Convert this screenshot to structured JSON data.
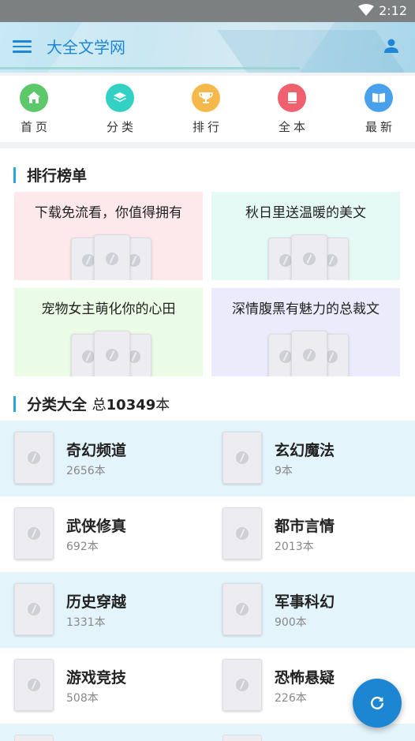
{
  "status_bar": {
    "time": "2:12"
  },
  "app_bar": {
    "title": "大全文学网",
    "menu_icon": "menu-icon",
    "user_icon": "user-icon"
  },
  "nav": [
    {
      "label": "首页",
      "icon": "home-icon",
      "color": "#5cc86a"
    },
    {
      "label": "分类",
      "icon": "layers-icon",
      "color": "#33d1c3"
    },
    {
      "label": "排行",
      "icon": "trophy-icon",
      "color": "#f5b84a"
    },
    {
      "label": "全本",
      "icon": "book-icon",
      "color": "#f0606e"
    },
    {
      "label": "最新",
      "icon": "open-book-icon",
      "color": "#4aa0ea"
    }
  ],
  "ranking": {
    "heading": "排行榜单",
    "cards": [
      {
        "title": "下载免流看，你值得拥有",
        "bg": "#fde9ec"
      },
      {
        "title": "秋日里送温暖的美文",
        "bg": "#e5faf4"
      },
      {
        "title": "宠物女主萌化你的心田",
        "bg": "#eafbe6"
      },
      {
        "title": "深情腹黑有魅力的总裁文",
        "bg": "#ebebfb"
      }
    ]
  },
  "categories": {
    "heading": "分类大全",
    "total_prefix": "总",
    "total": "10349",
    "total_suffix": "本",
    "items": [
      {
        "name": "奇幻频道",
        "count": "2656本"
      },
      {
        "name": "玄幻魔法",
        "count": "9本"
      },
      {
        "name": "武侠修真",
        "count": "692本"
      },
      {
        "name": "都市言情",
        "count": "2013本"
      },
      {
        "name": "历史穿越",
        "count": "1331本"
      },
      {
        "name": "军事科幻",
        "count": "900本"
      },
      {
        "name": "游戏竞技",
        "count": "508本"
      },
      {
        "name": "恐怖悬疑",
        "count": "226本"
      }
    ]
  },
  "fab": {
    "icon": "refresh-icon"
  }
}
